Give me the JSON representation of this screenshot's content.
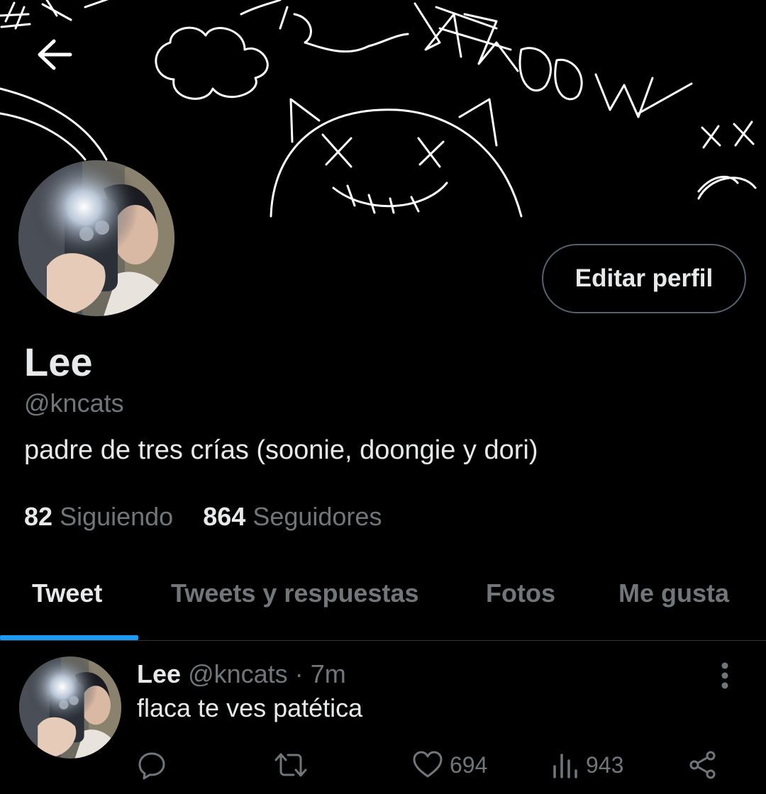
{
  "header": {
    "back_icon": "arrow-left-icon",
    "banner_doodle_text": "SHADOW"
  },
  "profile": {
    "display_name": "Lee",
    "handle": "@kncats",
    "bio": "padre de tres crías (soonie, doongie y dori)",
    "edit_button_label": "Editar perfil",
    "following_count": "82",
    "following_label": "Siguiendo",
    "followers_count": "864",
    "followers_label": "Seguidores"
  },
  "tabs": [
    {
      "label": "Tweet",
      "active": true
    },
    {
      "label": "Tweets y respuestas",
      "active": false
    },
    {
      "label": "Fotos",
      "active": false
    },
    {
      "label": "Me gusta",
      "active": false
    }
  ],
  "tweet": {
    "name": "Lee",
    "handle": "@kncats",
    "separator": "·",
    "time": "7m",
    "text": "flaca te ves patética",
    "reply_icon": "reply-icon",
    "retweet_icon": "retweet-icon",
    "like_icon": "heart-icon",
    "like_count": "694",
    "views_icon": "views-icon",
    "view_count": "943",
    "share_icon": "share-icon",
    "more_icon": "more-vertical-icon"
  },
  "colors": {
    "background": "#000000",
    "primary_text": "#e7e9ea",
    "secondary_text": "#71767b",
    "accent": "#1d9bf0",
    "border": "#536471"
  }
}
